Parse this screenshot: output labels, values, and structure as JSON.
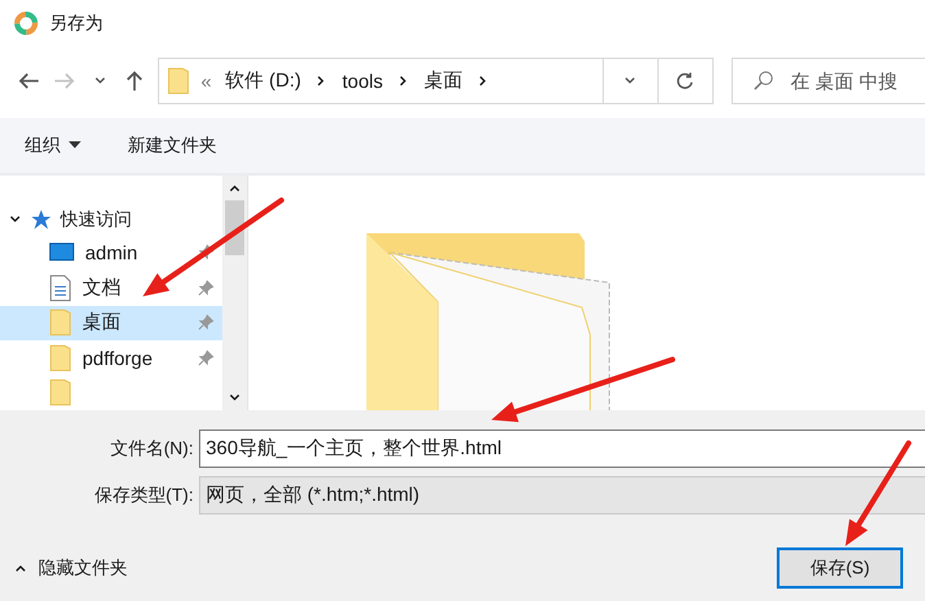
{
  "window": {
    "title": "另存为"
  },
  "address_bar": {
    "overflow": "«",
    "crumbs": [
      "软件 (D:)",
      "tools",
      "桌面"
    ]
  },
  "search": {
    "placeholder": "在 桌面 中搜"
  },
  "toolbar": {
    "organize": "组织",
    "new_folder": "新建文件夹"
  },
  "nav": {
    "section": {
      "label": "快速访问",
      "expanded": true
    },
    "items": [
      {
        "label": "admin",
        "kind": "desktop",
        "pinned": true,
        "selected": false
      },
      {
        "label": "文档",
        "kind": "document",
        "pinned": true,
        "selected": false
      },
      {
        "label": "桌面",
        "kind": "folder",
        "pinned": true,
        "selected": true
      },
      {
        "label": "pdfforge",
        "kind": "folder",
        "pinned": true,
        "selected": false
      }
    ]
  },
  "form": {
    "filename": {
      "label": "文件名(N):",
      "value": "360导航_一个主页，整个世界.html"
    },
    "filetype": {
      "label": "保存类型(T):",
      "value": "网页，全部 (*.htm;*.html)"
    }
  },
  "footer": {
    "toggle": "隐藏文件夹",
    "save_button": "保存(S)"
  }
}
